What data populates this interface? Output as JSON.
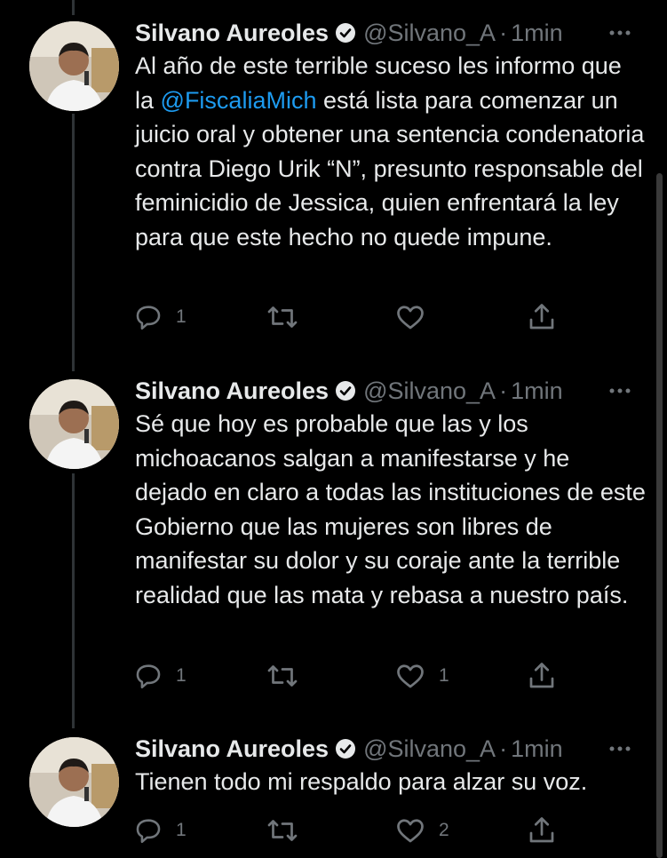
{
  "tweets": [
    {
      "name": "Silvano Aureoles",
      "handle": "@Silvano_A",
      "separator": "·",
      "time": "1min",
      "text_before": "Al año de este terrible suceso les informo que la ",
      "mention": "@FiscaliaMich",
      "text_after": " está lista para comenzar un juicio oral y obtener una sentencia condenatoria contra Diego Urik “N”, presunto responsable del feminicidio de Jessica, quien enfrentará la ley para que este hecho no quede impune.",
      "replies": "1",
      "retweets": "",
      "likes": ""
    },
    {
      "name": "Silvano Aureoles",
      "handle": "@Silvano_A",
      "separator": "·",
      "time": "1min",
      "text_before": "Sé que hoy es probable que las y los michoacanos salgan a manifestarse y he dejado en claro a todas las instituciones de este Gobierno que las mujeres son libres de manifestar su dolor y su coraje ante la terrible realidad que las mata y rebasa a nuestro país.",
      "mention": "",
      "text_after": "",
      "replies": "1",
      "retweets": "",
      "likes": "1"
    },
    {
      "name": "Silvano Aureoles",
      "handle": "@Silvano_A",
      "separator": "·",
      "time": "1min",
      "text_before": "Tienen todo mi respaldo para alzar su voz.",
      "mention": "",
      "text_after": "",
      "replies": "1",
      "retweets": "",
      "likes": "2"
    }
  ],
  "colors": {
    "background": "#000000",
    "text": "#e7e9ea",
    "secondary": "#71767b",
    "link": "#1d9bf0",
    "thread_line": "#2f3336"
  },
  "icons": [
    "verified-badge-icon",
    "more-options-icon",
    "reply-icon",
    "retweet-icon",
    "like-icon",
    "share-icon"
  ]
}
